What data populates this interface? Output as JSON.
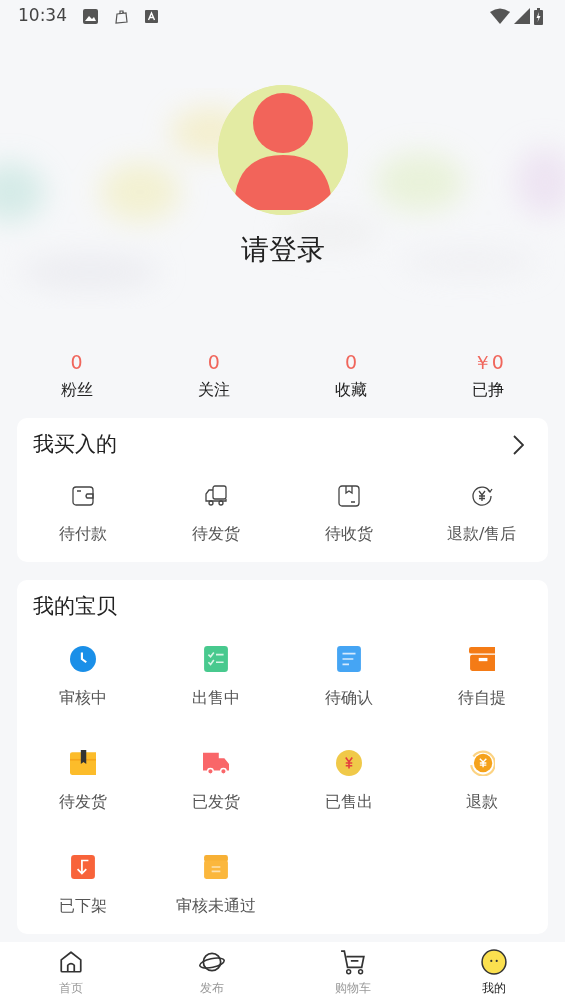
{
  "status_bar": {
    "time": "10:34"
  },
  "profile": {
    "name": "请登录"
  },
  "stats": [
    {
      "value": "0",
      "label": "粉丝"
    },
    {
      "value": "0",
      "label": "关注"
    },
    {
      "value": "0",
      "label": "收藏"
    },
    {
      "value": "￥0",
      "label": "已挣"
    }
  ],
  "bought": {
    "title": "我买入的",
    "items": [
      {
        "label": "待付款"
      },
      {
        "label": "待发货"
      },
      {
        "label": "待收货"
      },
      {
        "label": "退款/售后"
      }
    ]
  },
  "my_items": {
    "title": "我的宝贝",
    "items": [
      {
        "label": "审核中"
      },
      {
        "label": "出售中"
      },
      {
        "label": "待确认"
      },
      {
        "label": "待自提"
      },
      {
        "label": "待发货"
      },
      {
        "label": "已发货"
      },
      {
        "label": "已售出"
      },
      {
        "label": "退款"
      },
      {
        "label": "已下架"
      },
      {
        "label": "审核未通过"
      }
    ]
  },
  "tab_bar": [
    {
      "label": "首页",
      "selected": false
    },
    {
      "label": "发布",
      "selected": false
    },
    {
      "label": "购物车",
      "selected": false
    },
    {
      "label": "我的",
      "selected": true
    }
  ]
}
